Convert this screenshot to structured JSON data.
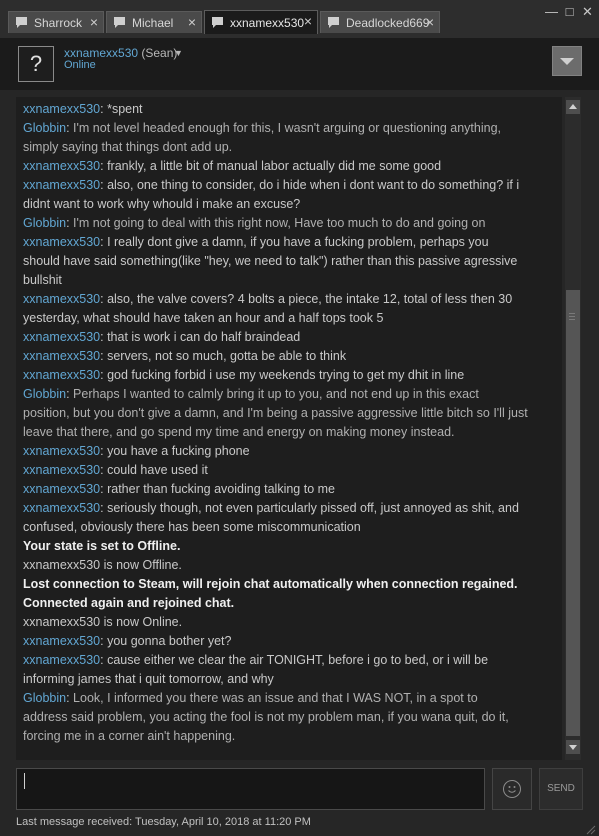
{
  "tabs": [
    {
      "label": "Sharrock",
      "close": "×"
    },
    {
      "label": "Michael",
      "close": "×"
    },
    {
      "label": "xxnamexx530",
      "close": "×"
    },
    {
      "label": "Deadlocked669",
      "close": "×"
    }
  ],
  "window": {
    "minimize": "—",
    "maximize": "□",
    "close": "✕"
  },
  "friend": {
    "name": "xxnamexx530",
    "alias": " (Sean)",
    "caret": "▼",
    "status": "Online",
    "avatar_glyph": "?"
  },
  "messages": [
    {
      "kind": "self",
      "user": "xxnamexx530",
      "lines": [
        "*spent"
      ]
    },
    {
      "kind": "other",
      "user": "Globbin",
      "lines": [
        "I'm not level headed enough for this, I wasn't arguing or questioning anything,",
        "simply saying that things dont add up."
      ]
    },
    {
      "kind": "self",
      "user": "xxnamexx530",
      "lines": [
        "frankly, a little bit of manual labor actually did me some good"
      ]
    },
    {
      "kind": "self",
      "user": "xxnamexx530",
      "lines": [
        "also, one thing to consider, do i hide when i dont want to do something? if i",
        "didnt want to work why whould i make an excuse?"
      ]
    },
    {
      "kind": "other",
      "user": "Globbin",
      "lines": [
        "I'm not going to deal with this right now, Have too much to do and going on"
      ]
    },
    {
      "kind": "self",
      "user": "xxnamexx530",
      "lines": [
        "I really dont give a damn, if you have a fucking problem, perhaps you",
        "should have said something(like \"hey, we need to talk\") rather than this passive agressive",
        "bullshit"
      ]
    },
    {
      "kind": "self",
      "user": "xxnamexx530",
      "lines": [
        "also, the valve covers? 4 bolts a piece, the intake 12, total of less then 30",
        "yesterday, what should have taken an hour and a half tops took 5"
      ]
    },
    {
      "kind": "self",
      "user": "xxnamexx530",
      "lines": [
        "that is work i can do half braindead"
      ]
    },
    {
      "kind": "self",
      "user": "xxnamexx530",
      "lines": [
        "servers, not so much, gotta be able to think"
      ]
    },
    {
      "kind": "self",
      "user": "xxnamexx530",
      "lines": [
        "god fucking forbid i use my weekends trying to get my dhit in line"
      ]
    },
    {
      "kind": "other",
      "user": "Globbin",
      "lines": [
        "Perhaps I wanted to calmly bring it up to you, and not end up in this exact",
        "position, but you don't give a damn, and I'm being a passive aggressive little bitch so I'll just",
        "leave that there, and go spend my time and energy on making money instead."
      ]
    },
    {
      "kind": "self",
      "user": "xxnamexx530",
      "lines": [
        "you have a fucking phone"
      ]
    },
    {
      "kind": "self",
      "user": "xxnamexx530",
      "lines": [
        "could have used it"
      ]
    },
    {
      "kind": "self",
      "user": "xxnamexx530",
      "lines": [
        "rather than fucking avoiding talking to me"
      ]
    },
    {
      "kind": "self",
      "user": "xxnamexx530",
      "lines": [
        "seriously though, not even particularly pissed off, just annoyed as shit, and",
        "confused, obviously there has been some miscommunication"
      ]
    },
    {
      "kind": "sys-bold",
      "lines": [
        "Your state is set to Offline."
      ]
    },
    {
      "kind": "sys",
      "lines": [
        "xxnamexx530 is now Offline."
      ]
    },
    {
      "kind": "sys-bold",
      "lines": [
        "Lost connection to Steam, will rejoin chat automatically when connection regained."
      ]
    },
    {
      "kind": "sys-bold",
      "lines": [
        "Connected again and rejoined chat."
      ]
    },
    {
      "kind": "sys",
      "lines": [
        "xxnamexx530 is now Online."
      ]
    },
    {
      "kind": "self",
      "user": "xxnamexx530",
      "lines": [
        "you gonna bother yet?"
      ]
    },
    {
      "kind": "self",
      "user": "xxnamexx530",
      "lines": [
        "cause either we clear the air TONIGHT, before i go to bed, or i will be",
        "informing james that i quit tomorrow, and why"
      ]
    },
    {
      "kind": "other",
      "user": "Globbin",
      "lines": [
        "Look, I informed you there was an issue and that I WAS NOT, in a spot to",
        "address said problem, you acting the fool is not my problem man, if you wana quit, do it,",
        "forcing me in a corner ain't happening."
      ]
    }
  ],
  "composer": {
    "value": "",
    "send_label": "SEND"
  },
  "footer": {
    "last_message": "Last message received: Tuesday, April 10, 2018 at 11:20 PM"
  },
  "colors": {
    "username": "#62a7d3",
    "background": "#1e1e1e",
    "text": "#c9c9c9"
  },
  "icons": {
    "tab": "chat-bubble-icon",
    "menu": "chevron-down-icon",
    "emoji": "smiley-icon",
    "resize": "resize-grip-icon"
  }
}
